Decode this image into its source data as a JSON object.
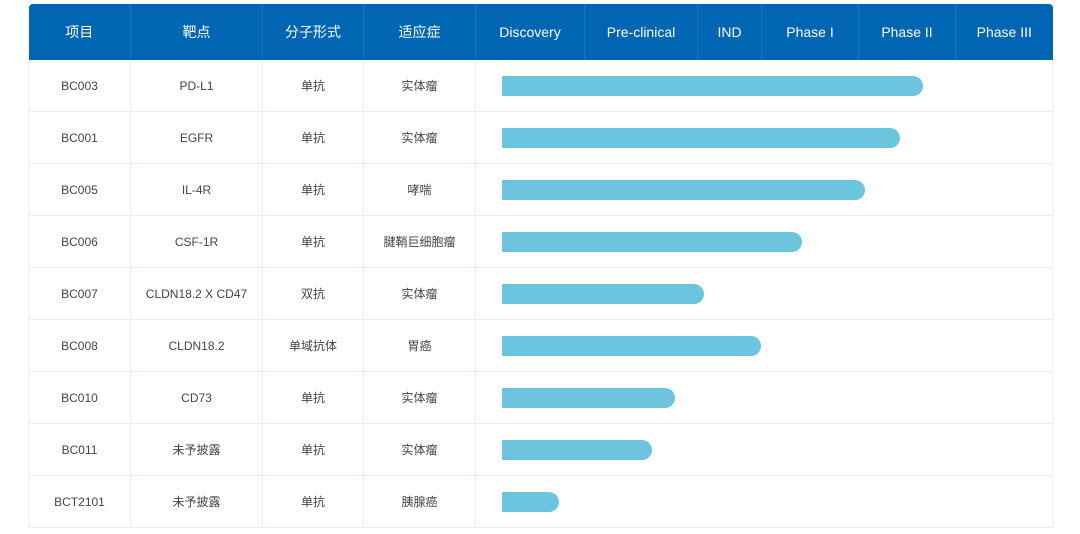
{
  "header": {
    "columns": [
      "项目",
      "靶点",
      "分子形式",
      "适应症"
    ],
    "stages": [
      "Discovery",
      "Pre-clinical",
      "IND",
      "Phase I",
      "Phase II",
      "Phase III"
    ]
  },
  "colors": {
    "header_bg": "#0066b3",
    "bar": "#6bc5de"
  },
  "rows": [
    {
      "project": "BC003",
      "target": "PD-L1",
      "format": "单抗",
      "indication": "实体瘤",
      "progress": 0.775
    },
    {
      "project": "BC001",
      "target": "EGFR",
      "format": "单抗",
      "indication": "实体瘤",
      "progress": 0.735
    },
    {
      "project": "BC005",
      "target": "IL-4R",
      "format": "单抗",
      "indication": "哮喘",
      "progress": 0.674
    },
    {
      "project": "BC006",
      "target": "CSF-1R",
      "format": "单抗",
      "indication": "腱鞘巨细胞瘤",
      "progress": 0.565
    },
    {
      "project": "BC007",
      "target": "CLDN18.2 X CD47",
      "format": "双抗",
      "indication": "实体瘤",
      "progress": 0.395
    },
    {
      "project": "BC008",
      "target": "CLDN18.2",
      "format": "单域抗体",
      "indication": "胃癌",
      "progress": 0.494
    },
    {
      "project": "BC010",
      "target": "CD73",
      "format": "单抗",
      "indication": "实体瘤",
      "progress": 0.345
    },
    {
      "project": "BC011",
      "target": "未予披露",
      "format": "单抗",
      "indication": "实体瘤",
      "progress": 0.305
    },
    {
      "project": "BCT2101",
      "target": "未予披露",
      "format": "单抗",
      "indication": "胰腺癌",
      "progress": 0.144
    }
  ]
}
